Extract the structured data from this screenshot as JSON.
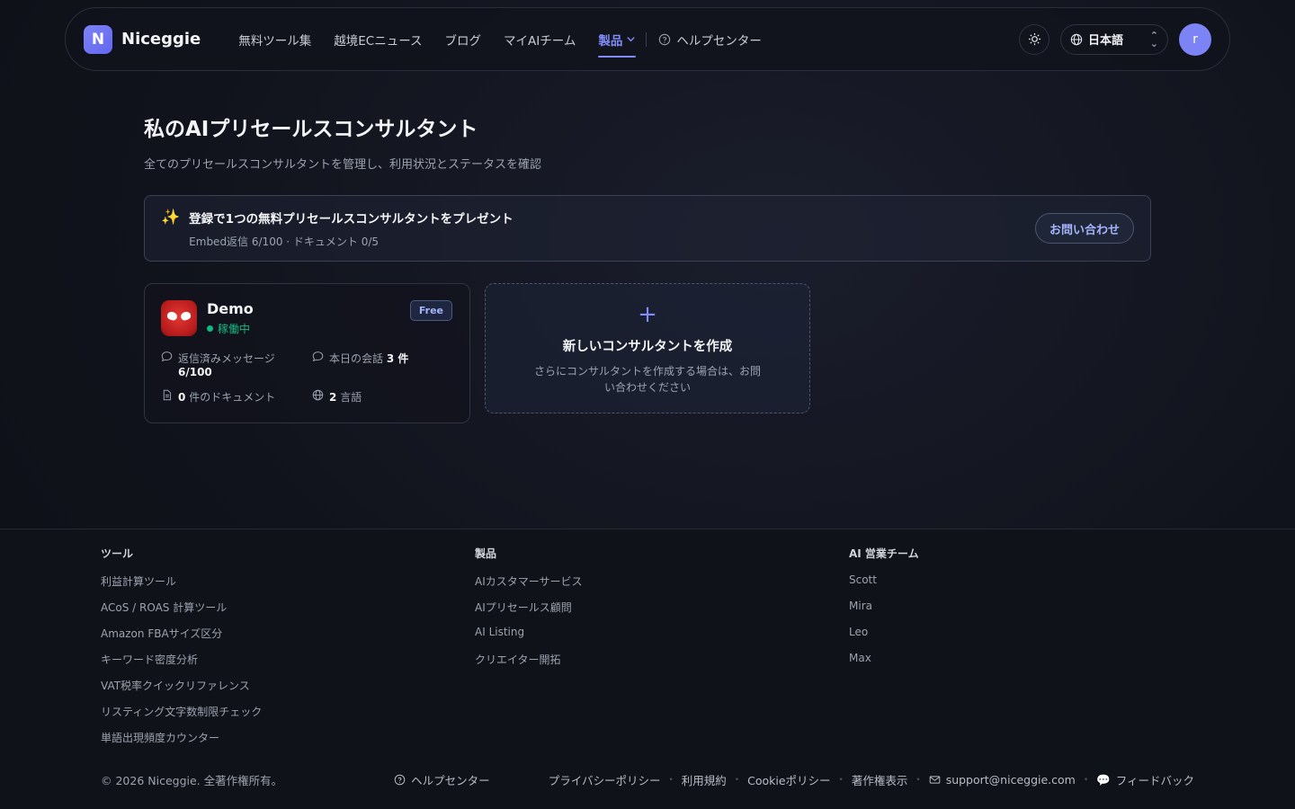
{
  "nav": {
    "logo_letter": "N",
    "brand": "Niceggie",
    "links": [
      "無料ツール集",
      "越境ECニュース",
      "ブログ",
      "マイAIチーム"
    ],
    "active_link": "製品",
    "help": "ヘルプセンター",
    "language": "日本語",
    "avatar_letter": "r",
    "accent_color": "#818cf8"
  },
  "page": {
    "title": "私のAIプリセールスコンサルタント",
    "subtitle": "全てのプリセールスコンサルタントを管理し、利用状況とステータスを確認"
  },
  "banner": {
    "title": "登録で1つの無料プリセールスコンサルタントをプレゼント",
    "sub": "Embed返信 6/100 · ドキュメント 0/5",
    "button": "お問い合わせ"
  },
  "bot_card": {
    "name": "Demo",
    "status": "稼働中",
    "plan": "Free",
    "replied_label": "返信済みメッセージ",
    "replied_value": "6/100",
    "today_label": "本日の会話",
    "today_value": "3 件",
    "docs_value": "0",
    "docs_label": "件のドキュメント",
    "langs_value": "2",
    "langs_label": "言語"
  },
  "new_card": {
    "plus": "+",
    "title": "新しいコンサルタントを作成",
    "desc": "さらにコンサルタントを作成する場合は、お問い合わせください"
  },
  "footer": {
    "columns": [
      {
        "head": "ツール",
        "items": [
          "利益計算ツール",
          "ACoS / ROAS 計算ツール",
          "Amazon FBAサイズ区分",
          "キーワード密度分析",
          "VAT税率クイックリファレンス",
          "リスティング文字数制限チェック",
          "単語出現頻度カウンター"
        ]
      },
      {
        "head": "製品",
        "items": [
          "AIカスタマーサービス",
          "AIプリセールス顧問",
          "AI Listing",
          "クリエイター開拓"
        ]
      },
      {
        "head": "AI 営業チーム",
        "items": [
          "Scott",
          "Mira",
          "Leo",
          "Max"
        ]
      }
    ],
    "copyright": "© 2026 Niceggie. 全著作権所有。",
    "help": "ヘルプセンター",
    "links": [
      "プライバシーポリシー",
      "利用規約",
      "Cookieポリシー",
      "著作権表示"
    ],
    "email": "support@niceggie.com",
    "feedback": "フィードバック"
  }
}
